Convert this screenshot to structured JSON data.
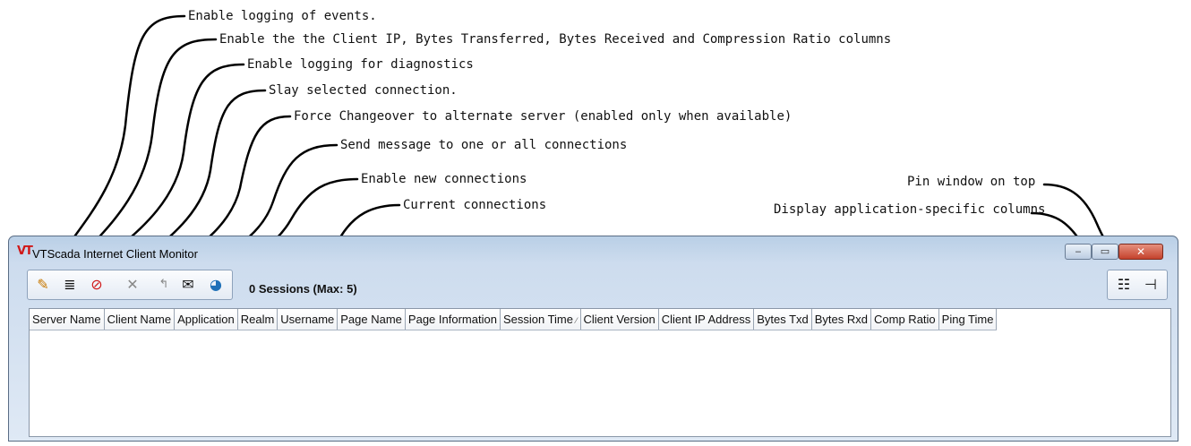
{
  "callouts": [
    "Enable logging of events.",
    "Enable the the Client IP, Bytes Transferred, Bytes Received and Compression Ratio columns",
    "Enable logging for diagnostics",
    "Slay selected connection.",
    "Force Changeover to alternate server (enabled only when available)",
    "Send message to one or all connections",
    "Enable new connections",
    "Current connections",
    "Pin window on top",
    "Display application-specific columns"
  ],
  "window": {
    "logo": "VT",
    "title": "VTScada Internet Client Monitor",
    "minimize": "‒",
    "maximize": "▭",
    "close": "✕"
  },
  "toolbar": {
    "icons": [
      "event-log-icon",
      "columns-icon",
      "diagnostics-icon",
      "slay-icon",
      "changeover-icon",
      "message-icon",
      "new-connections-icon"
    ],
    "glyphs": [
      "✎",
      "≣",
      "⊘",
      "✕",
      "↰",
      "✉",
      "◕"
    ],
    "right_glyphs": [
      "☷",
      "⊣"
    ],
    "sessions": "0 Sessions (Max: 5)"
  },
  "columns": [
    "Server Name",
    "Client Name",
    "Application",
    "Realm",
    "Username",
    "Page Name",
    "Page Information",
    "Session Time",
    "Client Version",
    "Client IP Address",
    "Bytes Txd",
    "Bytes Rxd",
    "Comp Ratio",
    "Ping Time"
  ],
  "sort_indicator": "⁄",
  "colors": {
    "close_red": "#c4422c",
    "logo_red": "#d01818"
  }
}
